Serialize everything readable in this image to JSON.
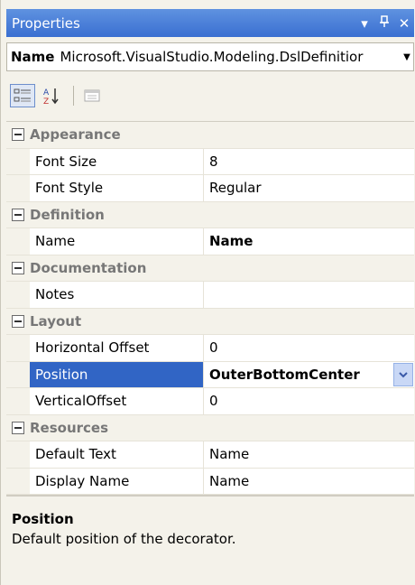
{
  "window": {
    "title": "Properties",
    "buttons": {
      "dropdown": "▾",
      "pin": "ᐩ",
      "close": "✕"
    }
  },
  "name_bar": {
    "label": "Name",
    "value": "Microsoft.VisualStudio.Modeling.DslDefinitior"
  },
  "toolbar": {
    "icons": [
      "categorized-icon",
      "alphabetical-icon",
      "property-pages-icon"
    ]
  },
  "grid": {
    "categories": [
      {
        "name": "Appearance",
        "rows": [
          {
            "name": "Font Size",
            "value": "8"
          },
          {
            "name": "Font Style",
            "value": "Regular"
          }
        ]
      },
      {
        "name": "Definition",
        "rows": [
          {
            "name": "Name",
            "value": "Name"
          }
        ]
      },
      {
        "name": "Documentation",
        "rows": [
          {
            "name": "Notes",
            "value": ""
          }
        ]
      },
      {
        "name": "Layout",
        "rows": [
          {
            "name": "Horizontal Offset",
            "value": "0"
          },
          {
            "name": "Position",
            "value": "OuterBottomCenter"
          },
          {
            "name": "VerticalOffset",
            "value": "0"
          }
        ]
      },
      {
        "name": "Resources",
        "rows": [
          {
            "name": "Default Text",
            "value": "Name"
          },
          {
            "name": "Display Name",
            "value": "Name"
          }
        ]
      }
    ]
  },
  "description": {
    "title": "Position",
    "text": "Default position of the decorator."
  },
  "colors": {
    "titlebar": "#3a6fd1",
    "selection": "#3165c5",
    "background": "#f4f2ea"
  }
}
